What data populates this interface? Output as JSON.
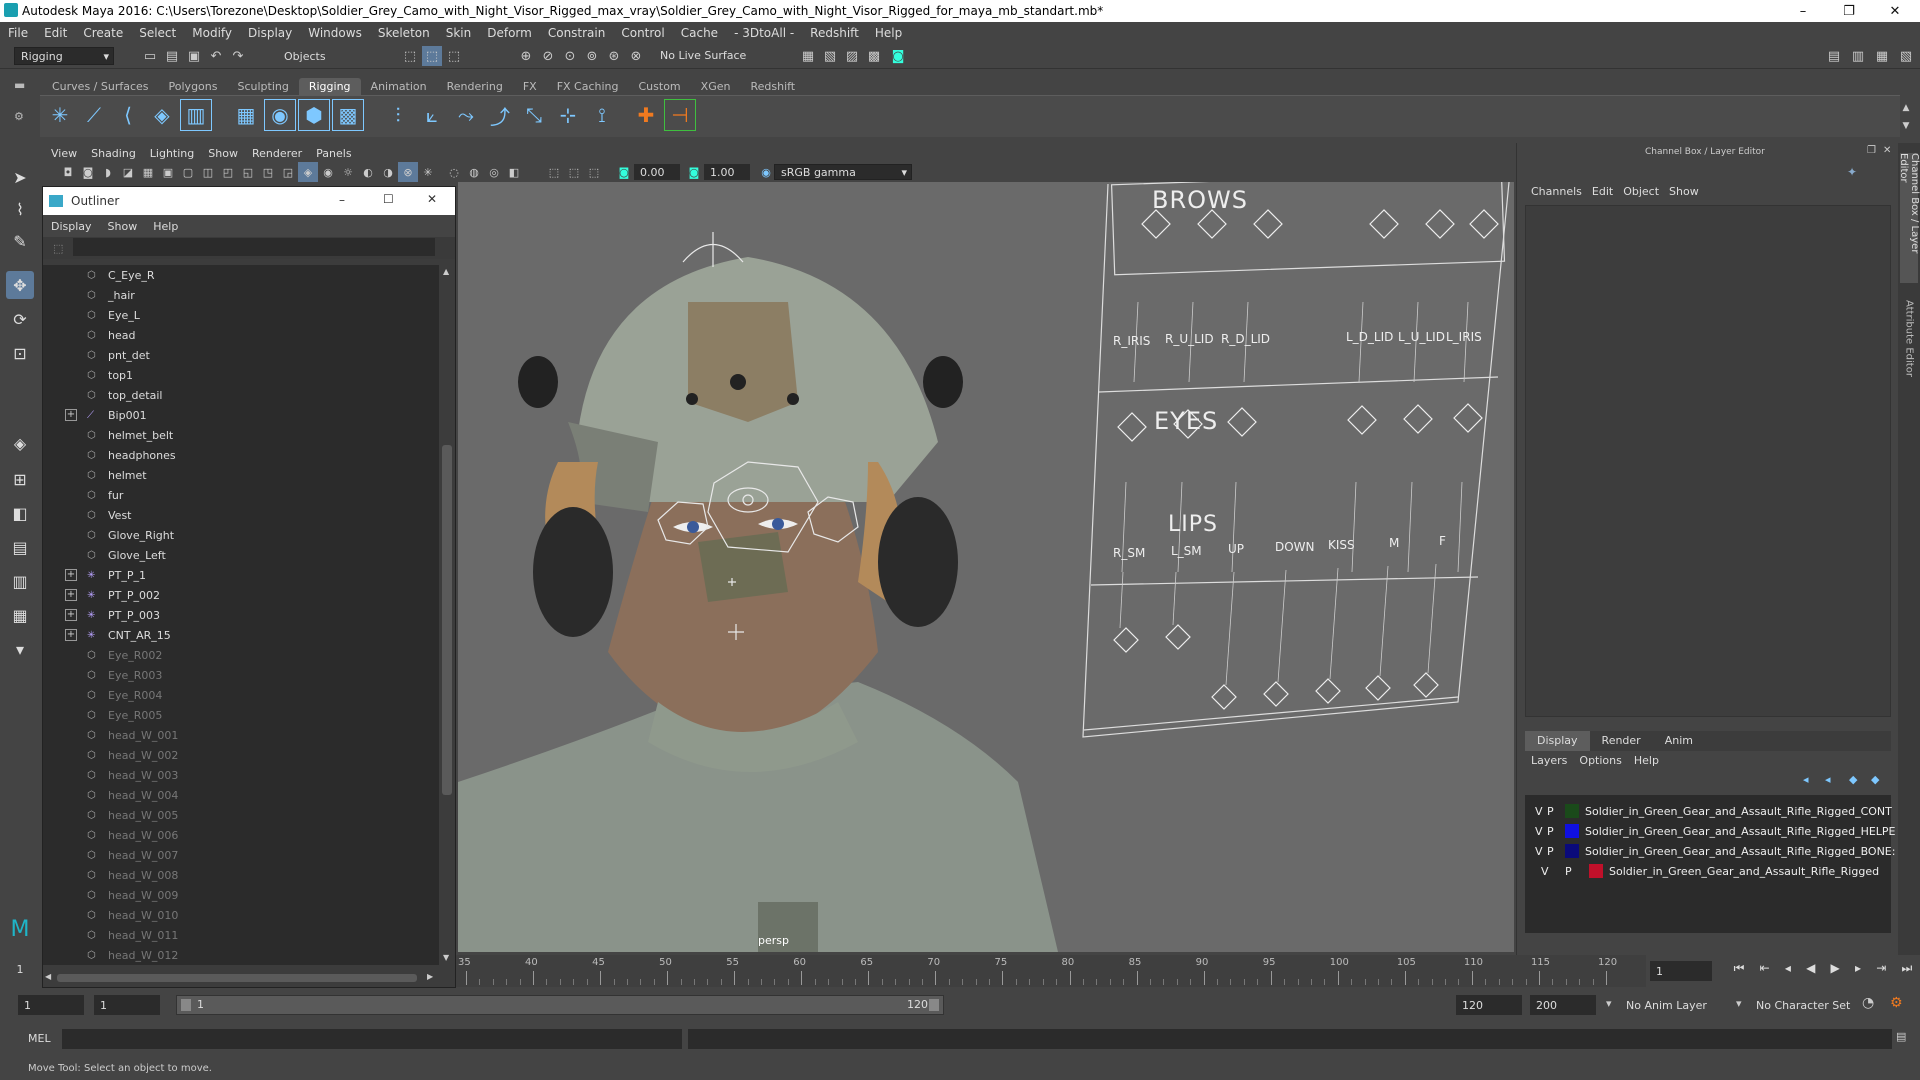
{
  "window": {
    "title": "Autodesk Maya 2016: C:\\Users\\Torezone\\Desktop\\Soldier_Grey_Camo_with_Night_Visor_Rigged_max_vray\\Soldier_Grey_Camo_with_Night_Visor_Rigged_for_maya_mb_standart.mb*",
    "minimize": "–",
    "maximize": "❐",
    "close": "✕"
  },
  "menubar": [
    "File",
    "Edit",
    "Create",
    "Select",
    "Modify",
    "Display",
    "Windows",
    "Skeleton",
    "Skin",
    "Deform",
    "Constrain",
    "Control",
    "Cache",
    "- 3DtoAll -",
    "Redshift",
    "Help"
  ],
  "statusline": {
    "menuset": "Rigging",
    "objects": "Objects",
    "live_surface": "No Live Surface"
  },
  "shelf": {
    "tabs": [
      "Curves / Surfaces",
      "Polygons",
      "Sculpting",
      "Rigging",
      "Animation",
      "Rendering",
      "FX",
      "FX Caching",
      "Custom",
      "XGen",
      "Redshift"
    ],
    "active": "Rigging"
  },
  "viewport": {
    "menu": [
      "View",
      "Shading",
      "Lighting",
      "Show",
      "Renderer",
      "Panels"
    ],
    "exposure": "0.00",
    "gamma": "1.00",
    "colorspace": "sRGB gamma",
    "camera": "persp",
    "face_panel": {
      "brows": "BROWS",
      "eyes": "EYES",
      "lips": "LIPS",
      "eye_labels": [
        "R_IRIS",
        "R_U_LID",
        "R_D_LID",
        "L_D_LID",
        "L_U_LID",
        "L_IRIS"
      ],
      "lip_labels": [
        "R_SM",
        "L_SM",
        "UP",
        "DOWN",
        "KISS",
        "M",
        "F"
      ]
    }
  },
  "outliner": {
    "title": "Outliner",
    "menu": [
      "Display",
      "Show",
      "Help"
    ],
    "items": [
      {
        "label": "C_Eye_R",
        "expand": false,
        "icon": "mesh",
        "dim": false
      },
      {
        "label": "_hair",
        "expand": false,
        "icon": "mesh",
        "dim": false
      },
      {
        "label": "Eye_L",
        "expand": false,
        "icon": "mesh",
        "dim": false
      },
      {
        "label": "head",
        "expand": false,
        "icon": "mesh",
        "dim": false
      },
      {
        "label": "pnt_det",
        "expand": false,
        "icon": "mesh",
        "dim": false
      },
      {
        "label": "top1",
        "expand": false,
        "icon": "mesh",
        "dim": false
      },
      {
        "label": "top_detail",
        "expand": false,
        "icon": "mesh",
        "dim": false
      },
      {
        "label": "Bip001",
        "expand": true,
        "icon": "joint",
        "dim": false
      },
      {
        "label": "helmet_belt",
        "expand": false,
        "icon": "mesh",
        "dim": false
      },
      {
        "label": "headphones",
        "expand": false,
        "icon": "mesh",
        "dim": false
      },
      {
        "label": "helmet",
        "expand": false,
        "icon": "mesh",
        "dim": false
      },
      {
        "label": "fur",
        "expand": false,
        "icon": "mesh",
        "dim": false
      },
      {
        "label": "Vest",
        "expand": false,
        "icon": "mesh",
        "dim": false
      },
      {
        "label": "Glove_Right",
        "expand": false,
        "icon": "mesh",
        "dim": false
      },
      {
        "label": "Glove_Left",
        "expand": false,
        "icon": "mesh",
        "dim": false
      },
      {
        "label": "PT_P_1",
        "expand": true,
        "icon": "locator",
        "dim": false
      },
      {
        "label": "PT_P_002",
        "expand": true,
        "icon": "locator",
        "dim": false
      },
      {
        "label": "PT_P_003",
        "expand": true,
        "icon": "locator",
        "dim": false
      },
      {
        "label": "CNT_AR_15",
        "expand": true,
        "icon": "locator",
        "dim": false
      },
      {
        "label": "Eye_R002",
        "expand": false,
        "icon": "mesh",
        "dim": true
      },
      {
        "label": "Eye_R003",
        "expand": false,
        "icon": "mesh",
        "dim": true
      },
      {
        "label": "Eye_R004",
        "expand": false,
        "icon": "mesh",
        "dim": true
      },
      {
        "label": "Eye_R005",
        "expand": false,
        "icon": "mesh",
        "dim": true
      },
      {
        "label": "head_W_001",
        "expand": false,
        "icon": "mesh",
        "dim": true
      },
      {
        "label": "head_W_002",
        "expand": false,
        "icon": "mesh",
        "dim": true
      },
      {
        "label": "head_W_003",
        "expand": false,
        "icon": "mesh",
        "dim": true
      },
      {
        "label": "head_W_004",
        "expand": false,
        "icon": "mesh",
        "dim": true
      },
      {
        "label": "head_W_005",
        "expand": false,
        "icon": "mesh",
        "dim": true
      },
      {
        "label": "head_W_006",
        "expand": false,
        "icon": "mesh",
        "dim": true
      },
      {
        "label": "head_W_007",
        "expand": false,
        "icon": "mesh",
        "dim": true
      },
      {
        "label": "head_W_008",
        "expand": false,
        "icon": "mesh",
        "dim": true
      },
      {
        "label": "head_W_009",
        "expand": false,
        "icon": "mesh",
        "dim": true
      },
      {
        "label": "head_W_010",
        "expand": false,
        "icon": "mesh",
        "dim": true
      },
      {
        "label": "head_W_011",
        "expand": false,
        "icon": "mesh",
        "dim": true
      },
      {
        "label": "head_W_012",
        "expand": false,
        "icon": "mesh",
        "dim": true
      }
    ]
  },
  "channelbox": {
    "title": "Channel Box / Layer Editor",
    "menu": [
      "Channels",
      "Edit",
      "Object",
      "Show"
    ],
    "tabs": [
      "Display",
      "Render",
      "Anim"
    ],
    "active_tab": "Display",
    "layer_menu": [
      "Layers",
      "Options",
      "Help"
    ],
    "layers": [
      {
        "v": "V",
        "p": "P",
        "color": "#1a4a1a",
        "name": "Soldier_in_Green_Gear_and_Assault_Rifle_Rigged_CONT"
      },
      {
        "v": "V",
        "p": "P",
        "color": "#1010e0",
        "name": "Soldier_in_Green_Gear_and_Assault_Rifle_Rigged_HELPE"
      },
      {
        "v": "V",
        "p": "P",
        "color": "#0a0a7a",
        "name": "Soldier_in_Green_Gear_and_Assault_Rifle_Rigged_BONE:"
      },
      {
        "v": "V",
        "p": "P",
        "color": "#c0102a",
        "name": "Soldier_in_Green_Gear_and_Assault_Rifle_Rigged"
      }
    ]
  },
  "sidetabs": [
    "Channel Box / Layer Editor",
    "Attribute Editor"
  ],
  "timeline": {
    "ticks": [
      "35",
      "40",
      "45",
      "50",
      "55",
      "60",
      "65",
      "70",
      "75",
      "80",
      "85",
      "90",
      "95",
      "100",
      "105",
      "110",
      "115",
      "120"
    ],
    "current_frame": "1"
  },
  "range": {
    "start": "1",
    "start2": "1",
    "slider_start": "1",
    "slider_end": "120",
    "end": "120",
    "end2": "200",
    "anim_layer": "No Anim Layer",
    "char_set": "No Character Set"
  },
  "cmdline": {
    "label": "MEL"
  },
  "helpline": {
    "text": "Move Tool: Select an object to move."
  }
}
